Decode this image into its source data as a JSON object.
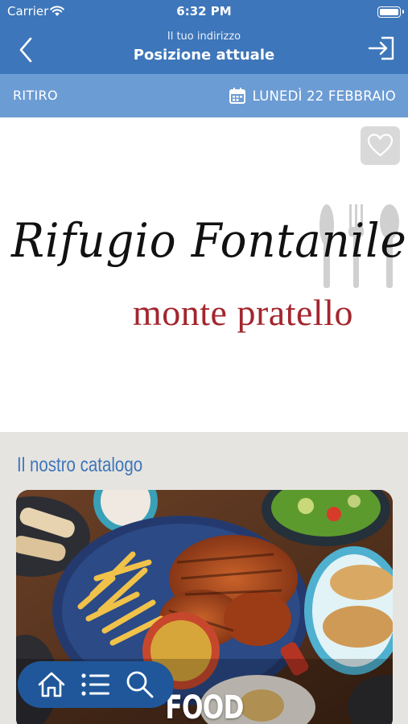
{
  "status_bar": {
    "carrier": "Carrier",
    "time": "6:32 PM"
  },
  "nav": {
    "subtitle": "Il tuo indirizzo",
    "title": "Posizione attuale"
  },
  "sub_bar": {
    "mode": "RITIRO",
    "date": "LUNEDÌ 22 FEBBRAIO"
  },
  "hero": {
    "logo_line1": "Rifugio Fontanile",
    "logo_line2": "monte pratello"
  },
  "catalog": {
    "title": "Il nostro catalogo",
    "card_label": "FOOD"
  },
  "icons": {
    "back": "chevron-left-icon",
    "login": "login-icon",
    "calendar": "calendar-icon",
    "favorite": "heart-icon",
    "home": "home-icon",
    "list": "list-icon",
    "search": "search-icon"
  },
  "colors": {
    "primary": "#3d76ba",
    "secondary": "#6c9cd4",
    "tab_bar": "#1f579a",
    "logo_red": "#a3262e"
  }
}
